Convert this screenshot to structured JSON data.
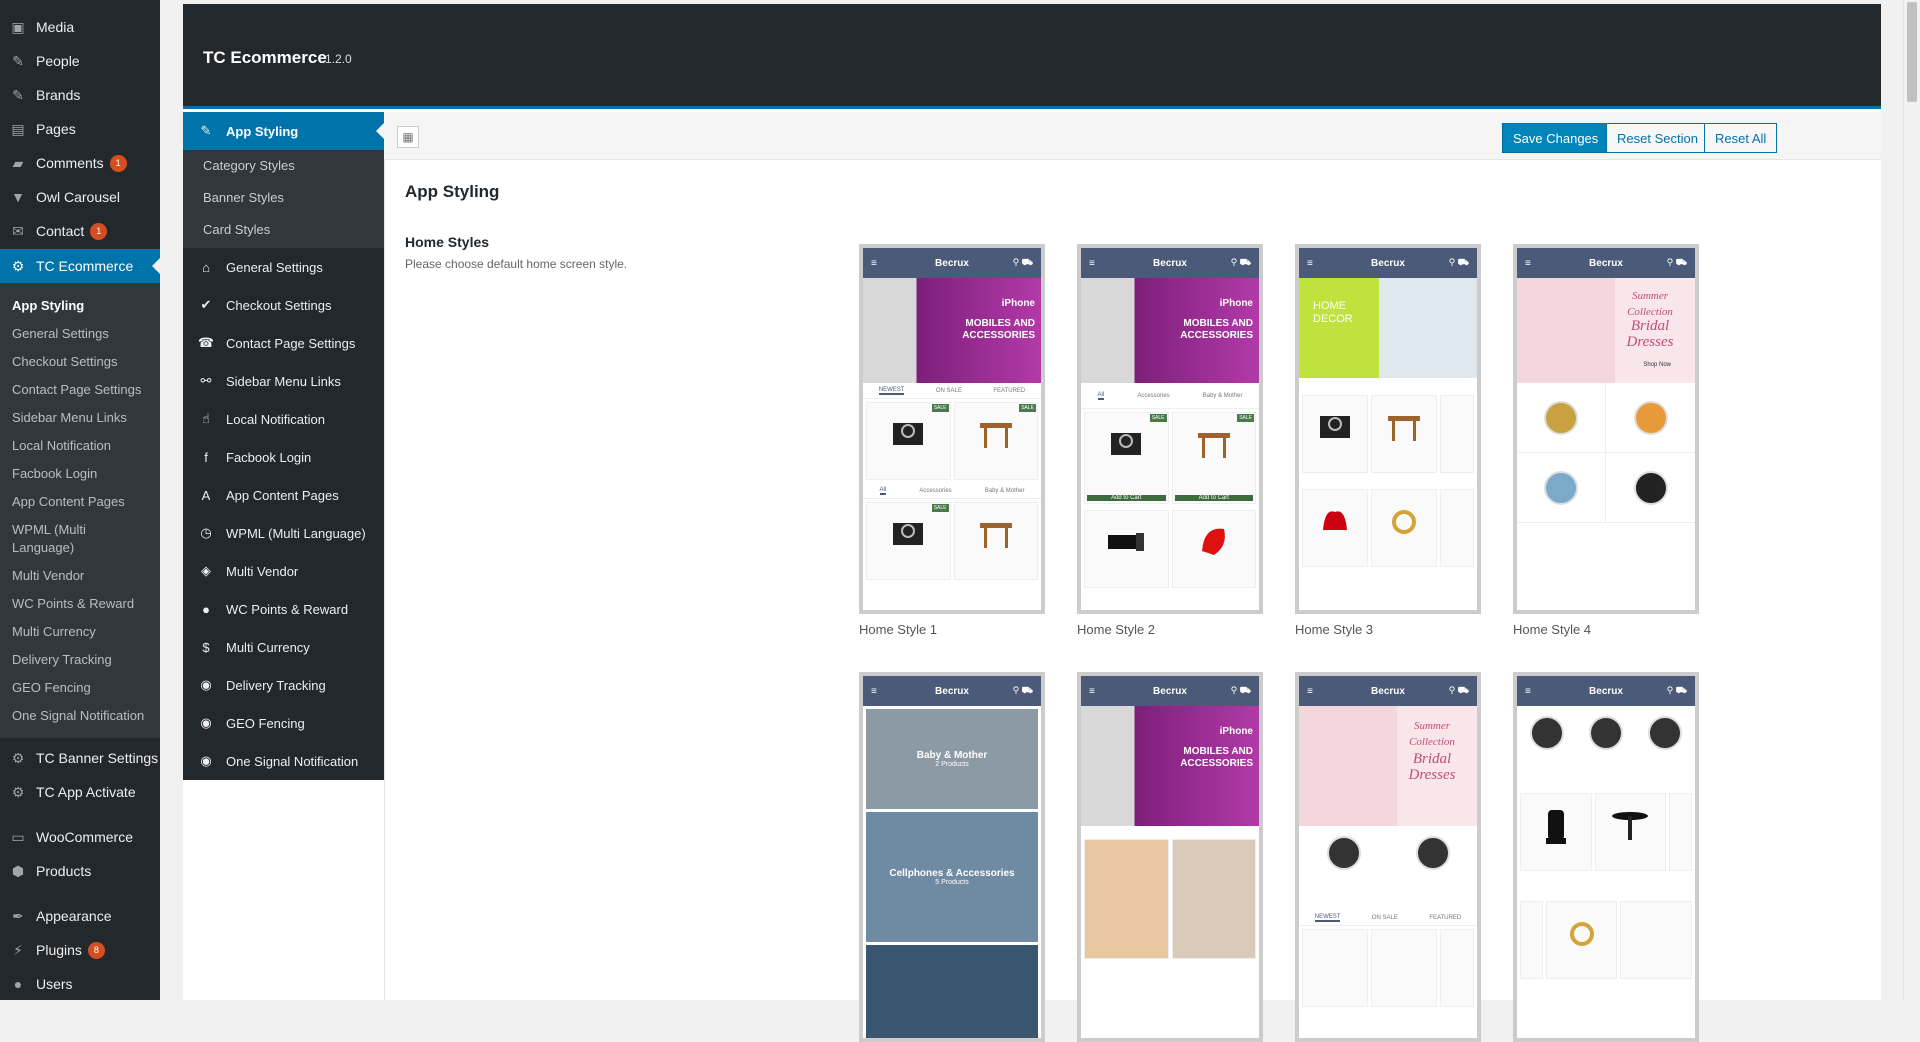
{
  "wp_menu": {
    "items": [
      {
        "label": "Media",
        "icon": "media-icon"
      },
      {
        "label": "People",
        "icon": "people-icon"
      },
      {
        "label": "Brands",
        "icon": "brands-icon"
      },
      {
        "label": "Pages",
        "icon": "pages-icon"
      },
      {
        "label": "Comments",
        "icon": "comments-icon",
        "badge": "1"
      },
      {
        "label": "Owl Carousel",
        "icon": "carousel-icon"
      },
      {
        "label": "Contact",
        "icon": "contact-icon",
        "badge": "1"
      },
      {
        "label": "TC Ecommerce",
        "icon": "gear-icon"
      }
    ],
    "sub_items": [
      "App Styling",
      "General Settings",
      "Checkout Settings",
      "Contact Page Settings",
      "Sidebar Menu Links",
      "Local Notification",
      "Facbook Login",
      "App Content Pages",
      "WPML (Multi Language)",
      "Multi Vendor",
      "WC Points & Reward",
      "Multi Currency",
      "Delivery Tracking",
      "GEO Fencing",
      "One Signal Notification"
    ],
    "after_items": [
      {
        "label": "TC Banner Settings",
        "icon": "gear-icon"
      },
      {
        "label": "TC App Activate",
        "icon": "gear-icon"
      },
      {
        "label": "WooCommerce",
        "icon": "woocommerce-icon"
      },
      {
        "label": "Products",
        "icon": "products-icon"
      },
      {
        "label": "Appearance",
        "icon": "appearance-icon"
      },
      {
        "label": "Plugins",
        "icon": "plugins-icon",
        "badge": "8"
      },
      {
        "label": "Users",
        "icon": "users-icon"
      }
    ]
  },
  "panel": {
    "title": "TC Ecommerce",
    "version": "1.2.0"
  },
  "tc_nav": {
    "active": "App Styling",
    "sub": [
      "Category Styles",
      "Banner Styles",
      "Card Styles"
    ],
    "items": [
      "General Settings",
      "Checkout Settings",
      "Contact Page Settings",
      "Sidebar Menu Links",
      "Local Notification",
      "Facbook Login",
      "App Content Pages",
      "WPML (Multi Language)",
      "Multi Vendor",
      "WC Points & Reward",
      "Multi Currency",
      "Delivery Tracking",
      "GEO Fencing",
      "One Signal Notification"
    ]
  },
  "toolbar": {
    "save": "Save Changes",
    "reset_section": "Reset Section",
    "reset_all": "Reset All"
  },
  "section": {
    "title": "App Styling",
    "field_label": "Home Styles",
    "field_desc": "Please choose default home screen style."
  },
  "thumbnails": {
    "app_name": "Becrux",
    "banner_text": "MOBILES AND ACCESSORIES",
    "banner_brand": "iPhone",
    "home_decor": "HOME DECOR",
    "summer": "Summer Collection",
    "bridal": "Bridal Dresses",
    "shop_now": "Shop Now",
    "tab_newest": "NEWEST",
    "tab_on_sale": "ON SALE",
    "tab_featured": "FEATURED",
    "tab_all": "All",
    "tab_accessories": "Accessories",
    "tab_baby": "Baby & Mother",
    "sale": "SALE",
    "add_to_cart": "Add to Cart",
    "baby_mother": "Baby & Mother",
    "cellphones": "Cellphones & Accessories",
    "products_2": "2 Products",
    "products_5": "5 Products",
    "labels": [
      "Home Style 1",
      "Home Style 2",
      "Home Style 3",
      "Home Style 4"
    ]
  }
}
